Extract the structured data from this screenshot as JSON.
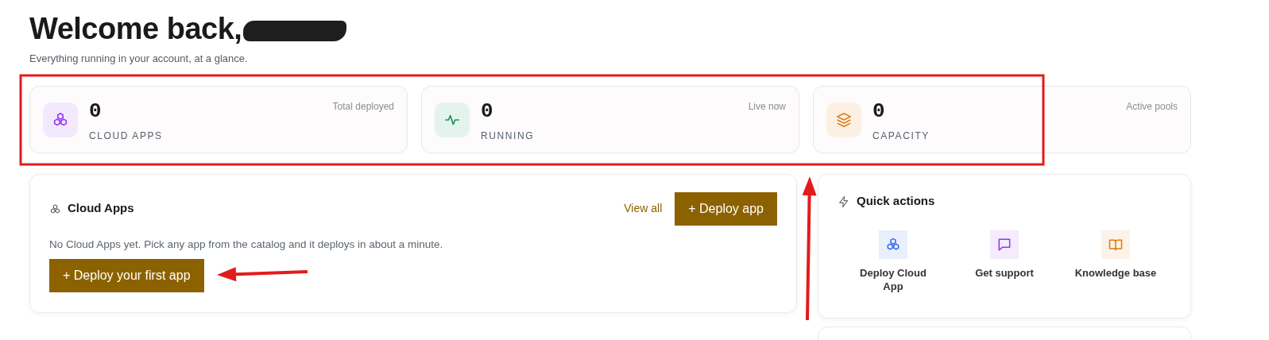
{
  "header": {
    "title": "Welcome back,",
    "name_redacted": true,
    "subtitle": "Everything running in your account, at a glance."
  },
  "stats": [
    {
      "value": "0",
      "label": "CLOUD APPS",
      "caption": "Total deployed"
    },
    {
      "value": "0",
      "label": "RUNNING",
      "caption": "Live now"
    },
    {
      "value": "0",
      "label": "CAPACITY",
      "caption": "Active pools"
    }
  ],
  "apps_panel": {
    "title": "Cloud Apps",
    "view_all": "View all",
    "deploy_button": "+ Deploy app",
    "empty_text": "No Cloud Apps yet. Pick any app from the catalog and it deploys in about a minute.",
    "first_app_button": "+ Deploy your first app"
  },
  "quick_actions": {
    "title": "Quick actions",
    "items": [
      {
        "label": "Deploy Cloud App"
      },
      {
        "label": "Get support"
      },
      {
        "label": "Knowledge base"
      }
    ]
  },
  "annotations": [
    {
      "kind": "box"
    },
    {
      "kind": "arrow"
    },
    {
      "kind": "arrow"
    }
  ]
}
